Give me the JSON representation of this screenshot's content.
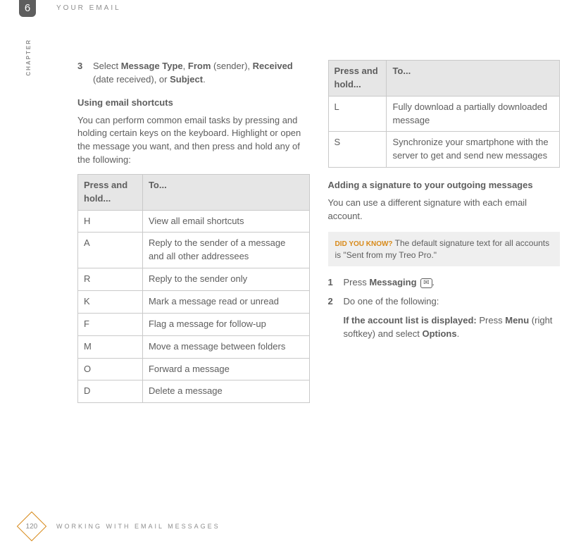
{
  "header": {
    "chapter_num": "6",
    "title": "YOUR EMAIL",
    "side_label": "CHAPTER"
  },
  "left": {
    "step3": {
      "num": "3",
      "prefix": "Select ",
      "b1": "Message Type",
      "sep1": ", ",
      "b2": "From",
      "paren1": " (sender), ",
      "b3": "Received",
      "paren2": " (date received), or ",
      "b4": "Subject",
      "end": "."
    },
    "subhead": "Using email shortcuts",
    "intro": "You can perform common email tasks by pressing and holding certain keys on the keyboard. Highlight or open the message you want, and then press and hold any of the following:",
    "th1": "Press and hold...",
    "th2": "To...",
    "rows": [
      {
        "k": "H",
        "v": "View all email shortcuts"
      },
      {
        "k": "A",
        "v": "Reply to the sender of a message and all other addressees"
      },
      {
        "k": "R",
        "v": "Reply to the sender only"
      },
      {
        "k": "K",
        "v": "Mark a message read or unread"
      },
      {
        "k": "F",
        "v": "Flag a message for follow-up"
      },
      {
        "k": "M",
        "v": "Move a message between folders"
      },
      {
        "k": "O",
        "v": "Forward a message"
      },
      {
        "k": "D",
        "v": "Delete a message"
      }
    ]
  },
  "right": {
    "th1": "Press and hold...",
    "th2": "To...",
    "rows": [
      {
        "k": "L",
        "v": "Fully download a partially downloaded message"
      },
      {
        "k": "S",
        "v": "Synchronize your smartphone with the server to get and send new messages"
      }
    ],
    "subhead": "Adding a signature to your outgoing messages",
    "intro": "You can use a different signature with each email account.",
    "tip_label": "DID YOU KNOW?",
    "tip_text": " The default signature text for all accounts is \"Sent from my Treo Pro.\"",
    "step1": {
      "num": "1",
      "prefix": "Press ",
      "b1": "Messaging",
      "icon": "✉",
      "end": "."
    },
    "step2": {
      "num": "2",
      "text": "Do one of the following:"
    },
    "opt1": {
      "b1": "If the account list is displayed:",
      "t1": " Press ",
      "b2": "Menu",
      "t2": " (right softkey) and select ",
      "b3": "Options",
      "end": "."
    }
  },
  "footer": {
    "page": "120",
    "text": "WORKING WITH EMAIL MESSAGES"
  }
}
